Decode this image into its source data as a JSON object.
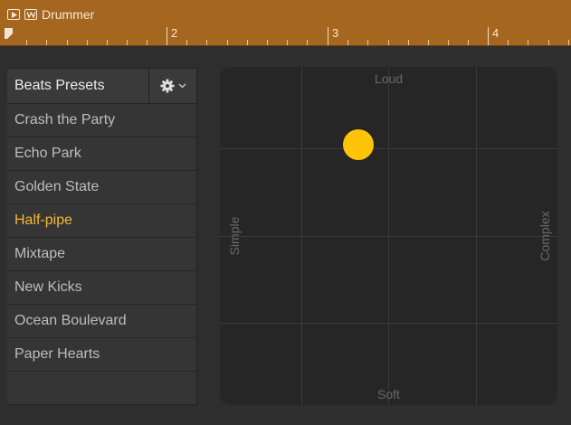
{
  "region": {
    "name": "Drummer",
    "bars": [
      "2",
      "3",
      "4"
    ],
    "color": "#a5661f"
  },
  "presets": {
    "title": "Beats Presets",
    "gear_icon": "gear-icon",
    "items": [
      {
        "label": "Crash the Party"
      },
      {
        "label": "Echo Park"
      },
      {
        "label": "Golden State"
      },
      {
        "label": "Half-pipe"
      },
      {
        "label": "Mixtape"
      },
      {
        "label": "New Kicks"
      },
      {
        "label": "Ocean Boulevard"
      },
      {
        "label": "Paper Hearts"
      }
    ],
    "selected": "Half-pipe",
    "selected_color": "#f4b934"
  },
  "pad": {
    "top_label": "Loud",
    "bottom_label": "Soft",
    "left_label": "Simple",
    "right_label": "Complex",
    "puck_color": "#fec508",
    "puck_complexity": 0.41,
    "puck_loudness": 0.77
  }
}
